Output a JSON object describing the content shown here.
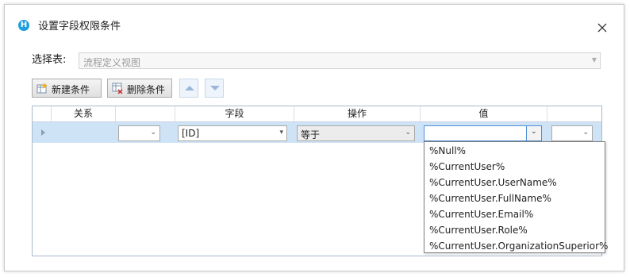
{
  "dialog": {
    "app_icon_letter": "H",
    "title": "设置字段权限条件",
    "close_glyph": "✕"
  },
  "table_select": {
    "label": "选择表:",
    "value": "流程定义视图",
    "arrow": "▼"
  },
  "toolbar": {
    "new_label": "新建条件",
    "delete_label": "删除条件",
    "move_up_icon": "arrow-up-icon",
    "move_down_icon": "arrow-down-icon"
  },
  "grid": {
    "headers": [
      "关系",
      "字段",
      "操作",
      "值"
    ],
    "row": {
      "relation": "",
      "field": "[ID]",
      "operation": "等于",
      "value": "",
      "extra": ""
    }
  },
  "value_options": [
    "%Null%",
    "%CurrentUser%",
    "%CurrentUser.UserName%",
    "%CurrentUser.FullName%",
    "%CurrentUser.Email%",
    "%CurrentUser.Role%",
    "%CurrentUser.OrganizationSuperior%"
  ],
  "colors": {
    "accent": "#1f9fe0",
    "selected_row": "#cfe3f6",
    "focus_border": "#4f8ed8"
  }
}
